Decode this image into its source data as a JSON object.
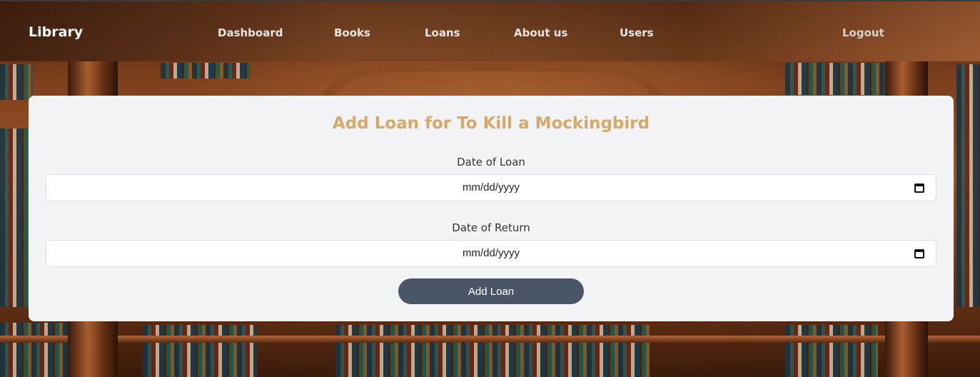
{
  "navbar": {
    "brand": "Library",
    "links": [
      {
        "label": "Dashboard"
      },
      {
        "label": "Books"
      },
      {
        "label": "Loans"
      },
      {
        "label": "About us"
      },
      {
        "label": "Users"
      }
    ],
    "logout": "Logout"
  },
  "form": {
    "title": "Add Loan for To Kill a Mockingbird",
    "loan_date": {
      "label": "Date of Loan",
      "value": "mm/dd/yyyy"
    },
    "return_date": {
      "label": "Date of Return",
      "value": "mm/dd/yyyy"
    },
    "submit_label": "Add Loan"
  },
  "icons": {
    "date_picker": "calendar-icon"
  },
  "colors": {
    "title": "#d6a86a",
    "button": "#4a5568",
    "card": "#f2f3f5"
  }
}
